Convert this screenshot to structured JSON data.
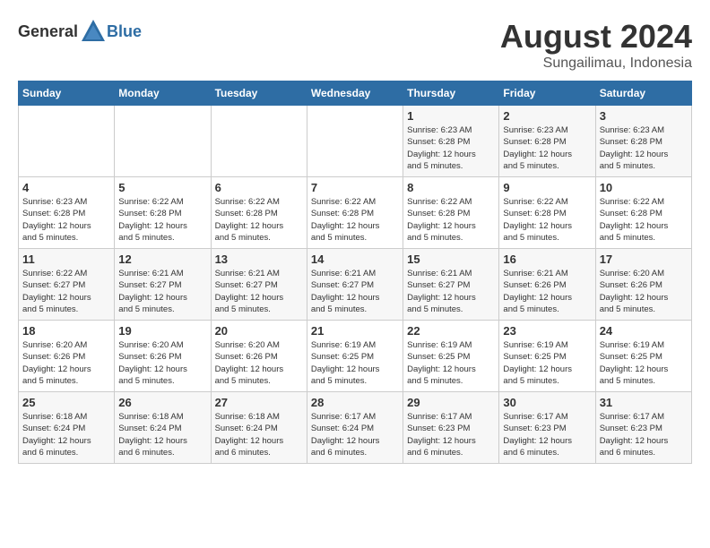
{
  "header": {
    "logo_general": "General",
    "logo_blue": "Blue",
    "month_year": "August 2024",
    "location": "Sungailimau, Indonesia"
  },
  "weekdays": [
    "Sunday",
    "Monday",
    "Tuesday",
    "Wednesday",
    "Thursday",
    "Friday",
    "Saturday"
  ],
  "weeks": [
    [
      {
        "day": "",
        "info": ""
      },
      {
        "day": "",
        "info": ""
      },
      {
        "day": "",
        "info": ""
      },
      {
        "day": "",
        "info": ""
      },
      {
        "day": "1",
        "info": "Sunrise: 6:23 AM\nSunset: 6:28 PM\nDaylight: 12 hours\nand 5 minutes."
      },
      {
        "day": "2",
        "info": "Sunrise: 6:23 AM\nSunset: 6:28 PM\nDaylight: 12 hours\nand 5 minutes."
      },
      {
        "day": "3",
        "info": "Sunrise: 6:23 AM\nSunset: 6:28 PM\nDaylight: 12 hours\nand 5 minutes."
      }
    ],
    [
      {
        "day": "4",
        "info": "Sunrise: 6:23 AM\nSunset: 6:28 PM\nDaylight: 12 hours\nand 5 minutes."
      },
      {
        "day": "5",
        "info": "Sunrise: 6:22 AM\nSunset: 6:28 PM\nDaylight: 12 hours\nand 5 minutes."
      },
      {
        "day": "6",
        "info": "Sunrise: 6:22 AM\nSunset: 6:28 PM\nDaylight: 12 hours\nand 5 minutes."
      },
      {
        "day": "7",
        "info": "Sunrise: 6:22 AM\nSunset: 6:28 PM\nDaylight: 12 hours\nand 5 minutes."
      },
      {
        "day": "8",
        "info": "Sunrise: 6:22 AM\nSunset: 6:28 PM\nDaylight: 12 hours\nand 5 minutes."
      },
      {
        "day": "9",
        "info": "Sunrise: 6:22 AM\nSunset: 6:28 PM\nDaylight: 12 hours\nand 5 minutes."
      },
      {
        "day": "10",
        "info": "Sunrise: 6:22 AM\nSunset: 6:28 PM\nDaylight: 12 hours\nand 5 minutes."
      }
    ],
    [
      {
        "day": "11",
        "info": "Sunrise: 6:22 AM\nSunset: 6:27 PM\nDaylight: 12 hours\nand 5 minutes."
      },
      {
        "day": "12",
        "info": "Sunrise: 6:21 AM\nSunset: 6:27 PM\nDaylight: 12 hours\nand 5 minutes."
      },
      {
        "day": "13",
        "info": "Sunrise: 6:21 AM\nSunset: 6:27 PM\nDaylight: 12 hours\nand 5 minutes."
      },
      {
        "day": "14",
        "info": "Sunrise: 6:21 AM\nSunset: 6:27 PM\nDaylight: 12 hours\nand 5 minutes."
      },
      {
        "day": "15",
        "info": "Sunrise: 6:21 AM\nSunset: 6:27 PM\nDaylight: 12 hours\nand 5 minutes."
      },
      {
        "day": "16",
        "info": "Sunrise: 6:21 AM\nSunset: 6:26 PM\nDaylight: 12 hours\nand 5 minutes."
      },
      {
        "day": "17",
        "info": "Sunrise: 6:20 AM\nSunset: 6:26 PM\nDaylight: 12 hours\nand 5 minutes."
      }
    ],
    [
      {
        "day": "18",
        "info": "Sunrise: 6:20 AM\nSunset: 6:26 PM\nDaylight: 12 hours\nand 5 minutes."
      },
      {
        "day": "19",
        "info": "Sunrise: 6:20 AM\nSunset: 6:26 PM\nDaylight: 12 hours\nand 5 minutes."
      },
      {
        "day": "20",
        "info": "Sunrise: 6:20 AM\nSunset: 6:26 PM\nDaylight: 12 hours\nand 5 minutes."
      },
      {
        "day": "21",
        "info": "Sunrise: 6:19 AM\nSunset: 6:25 PM\nDaylight: 12 hours\nand 5 minutes."
      },
      {
        "day": "22",
        "info": "Sunrise: 6:19 AM\nSunset: 6:25 PM\nDaylight: 12 hours\nand 5 minutes."
      },
      {
        "day": "23",
        "info": "Sunrise: 6:19 AM\nSunset: 6:25 PM\nDaylight: 12 hours\nand 5 minutes."
      },
      {
        "day": "24",
        "info": "Sunrise: 6:19 AM\nSunset: 6:25 PM\nDaylight: 12 hours\nand 5 minutes."
      }
    ],
    [
      {
        "day": "25",
        "info": "Sunrise: 6:18 AM\nSunset: 6:24 PM\nDaylight: 12 hours\nand 6 minutes."
      },
      {
        "day": "26",
        "info": "Sunrise: 6:18 AM\nSunset: 6:24 PM\nDaylight: 12 hours\nand 6 minutes."
      },
      {
        "day": "27",
        "info": "Sunrise: 6:18 AM\nSunset: 6:24 PM\nDaylight: 12 hours\nand 6 minutes."
      },
      {
        "day": "28",
        "info": "Sunrise: 6:17 AM\nSunset: 6:24 PM\nDaylight: 12 hours\nand 6 minutes."
      },
      {
        "day": "29",
        "info": "Sunrise: 6:17 AM\nSunset: 6:23 PM\nDaylight: 12 hours\nand 6 minutes."
      },
      {
        "day": "30",
        "info": "Sunrise: 6:17 AM\nSunset: 6:23 PM\nDaylight: 12 hours\nand 6 minutes."
      },
      {
        "day": "31",
        "info": "Sunrise: 6:17 AM\nSunset: 6:23 PM\nDaylight: 12 hours\nand 6 minutes."
      }
    ]
  ]
}
